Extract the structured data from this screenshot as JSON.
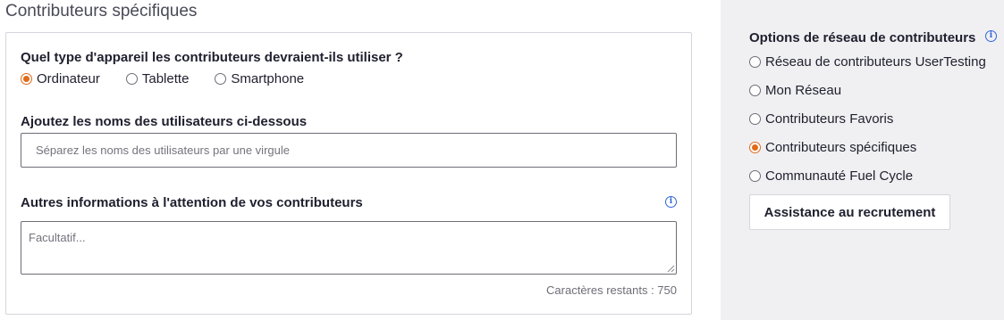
{
  "main": {
    "section_title": "Contributeurs spécifiques",
    "device_question": "Quel type d'appareil les contributeurs devraient-ils utiliser ?",
    "device_options": [
      {
        "label": "Ordinateur",
        "selected": true
      },
      {
        "label": "Tablette",
        "selected": false
      },
      {
        "label": "Smartphone",
        "selected": false
      }
    ],
    "usernames_label": "Ajoutez les noms des utilisateurs ci-dessous",
    "usernames_placeholder": "Séparez les noms des utilisateurs par une virgule",
    "usernames_value": "",
    "other_info_label": "Autres informations à l'attention de vos contributeurs",
    "other_info_placeholder": "Facultatif...",
    "other_info_value": "",
    "chars_remaining": "Caractères restants : 750"
  },
  "sidebar": {
    "title": "Options de réseau de contributeurs",
    "options": [
      {
        "label": "Réseau de contributeurs UserTesting",
        "selected": false
      },
      {
        "label": "Mon Réseau",
        "selected": false
      },
      {
        "label": "Contributeurs Favoris",
        "selected": false
      },
      {
        "label": "Contributeurs spécifiques",
        "selected": true
      },
      {
        "label": "Communauté Fuel Cycle",
        "selected": false
      }
    ],
    "assist_button": "Assistance au recrutement"
  },
  "colors": {
    "accent": "#e06a1b",
    "info": "#2f66d9",
    "sidebar_bg": "#f0f0f2"
  },
  "icons": {
    "info": "info-icon"
  }
}
